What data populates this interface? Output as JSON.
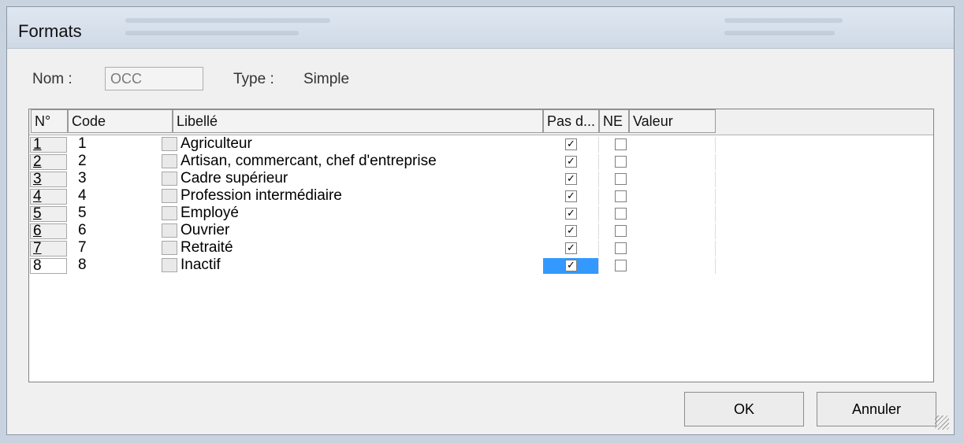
{
  "window": {
    "title": "Formats"
  },
  "form": {
    "name_label": "Nom :",
    "name_value": "OCC",
    "type_label": "Type :",
    "type_value": "Simple"
  },
  "table": {
    "headers": {
      "no": "N°",
      "code": "Code",
      "libelle": "Libellé",
      "pas_d": "Pas d...",
      "ne": "NE",
      "valeur": "Valeur"
    },
    "rows": [
      {
        "no": "1",
        "code": "1",
        "libelle": "Agriculteur",
        "pas_d": true,
        "ne": false
      },
      {
        "no": "2",
        "code": "2",
        "libelle": "Artisan, commercant, chef d'entreprise",
        "pas_d": true,
        "ne": false
      },
      {
        "no": "3",
        "code": "3",
        "libelle": "Cadre supérieur",
        "pas_d": true,
        "ne": false
      },
      {
        "no": "4",
        "code": "4",
        "libelle": "Profession intermédiaire",
        "pas_d": true,
        "ne": false
      },
      {
        "no": "5",
        "code": "5",
        "libelle": "Employé",
        "pas_d": true,
        "ne": false
      },
      {
        "no": "6",
        "code": "6",
        "libelle": "Ouvrier",
        "pas_d": true,
        "ne": false
      },
      {
        "no": "7",
        "code": "7",
        "libelle": "Retraité",
        "pas_d": true,
        "ne": false
      },
      {
        "no": "8",
        "code": "8",
        "libelle": "Inactif",
        "pas_d": true,
        "ne": false
      }
    ]
  },
  "buttons": {
    "ok": "OK",
    "cancel": "Annuler"
  },
  "colors": {
    "selection": "#3399ff"
  }
}
